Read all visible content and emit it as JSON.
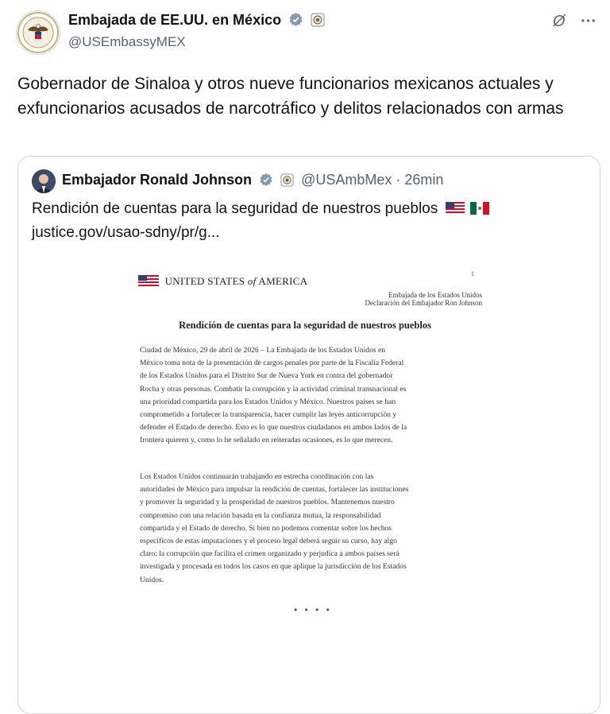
{
  "author": {
    "name": "Embajada de EE.UU. en México",
    "handle": "@USEmbassyMEX",
    "avatar_icon": "embassy-seal-icon",
    "verified_icon": "verified-badge-icon",
    "affiliate_icon": "seal-badge-icon"
  },
  "header_icons": {
    "grok": "Ø",
    "more": "···"
  },
  "tweet": {
    "text": "Gobernador de Sinaloa y otros nueve funcionarios mexicanos actuales y exfuncionarios acusados de narcotráfico y delitos relacionados con armas"
  },
  "quote": {
    "name": "Embajador Ronald Johnson",
    "handle_time": "@USAmbMex · 26min",
    "line1": "Rendición de cuentas para la seguridad de nuestros pueblos",
    "link": "justice.gov/usao-sdny/pr/g..."
  },
  "document": {
    "header": "UNITED STATES of AMERICA",
    "page_number": "1",
    "office_line1": "Embajada de los Estados Unidos",
    "office_line2": "Declaración del Embajador Ron Johnson",
    "title": "Rendición de cuentas para la seguridad de nuestros pueblos",
    "p1": [
      "Ciudad de México, 29 de abril de 2026 – La Embajada de los Estados Unidos en",
      "México toma nota de la presentación de cargos penales por parte de la Fiscalía Federal",
      "de los Estados Unidos para el Distrito Sur de Nueva York en contra del gobernador",
      "Rocha y otras personas. Combatir la corrupción y la actividad criminal transnacional es",
      "una prioridad compartida para los Estados Unidos y México. Nuestros países se han",
      "comprometido a fortalecer la transparencia, hacer cumplir las leyes anticorrupción y",
      "defender el Estado de derecho. Esto es lo que nuestros ciudadanos en ambos lados de la",
      "frontera quieren y, como lo he señalado en reiteradas ocasiones, es lo que merecen."
    ],
    "p2": [
      "Los Estados Unidos continuarán trabajando en estrecha coordinación con las",
      "autoridades de México para impulsar la rendición de cuentas, fortalecer las instituciones",
      "y promover la seguridad y la prosperidad de nuestros pueblos. Mantenemos nuestro",
      "compromiso con una relación basada en la confianza mutua, la responsabilidad",
      "compartida y el Estado de derecho. Si bien no podemos comentar sobre los hechos",
      "específicos de estas imputaciones y el proceso legal deberá seguir su curso, hay algo",
      "claro: la corrupción que facilita el crimen organizado y perjudica a ambos países será",
      "investigada y procesada en todos los casos en que aplique la jurisdicción de los Estados",
      "Unidos."
    ],
    "dots": "• • • •"
  }
}
